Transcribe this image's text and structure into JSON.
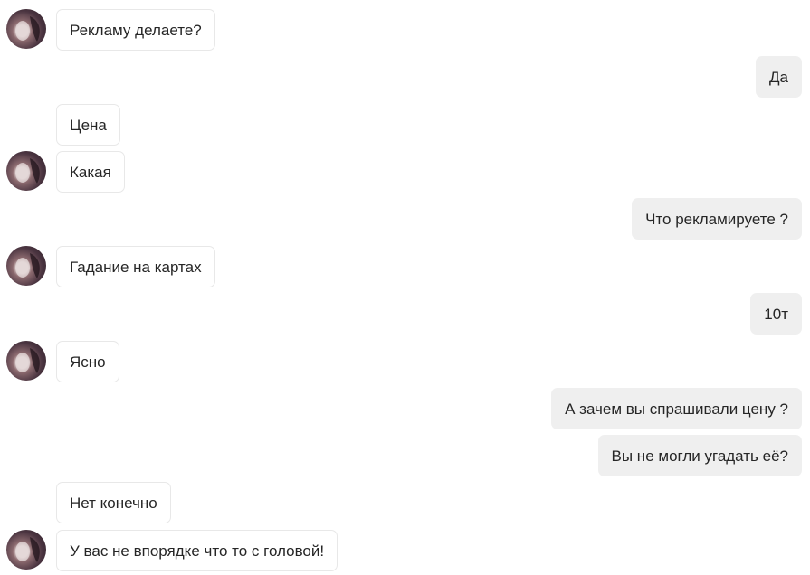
{
  "messages": [
    {
      "side": "in",
      "avatar": true,
      "text": "Рекламу делаете?"
    },
    {
      "side": "out",
      "avatar": false,
      "text": "Да"
    },
    {
      "side": "in",
      "avatar": false,
      "text": "Цена"
    },
    {
      "side": "in",
      "avatar": true,
      "text": "Какая"
    },
    {
      "side": "out",
      "avatar": false,
      "text": "Что рекламируете ?"
    },
    {
      "side": "in",
      "avatar": true,
      "text": "Гадание на картах"
    },
    {
      "side": "out",
      "avatar": false,
      "text": "10т"
    },
    {
      "side": "in",
      "avatar": true,
      "text": "Ясно"
    },
    {
      "side": "out",
      "avatar": false,
      "text": "А зачем вы спрашивали цену ?"
    },
    {
      "side": "out",
      "avatar": false,
      "text": "Вы не могли угадать её?"
    },
    {
      "side": "in",
      "avatar": false,
      "text": "Нет конечно"
    },
    {
      "side": "in",
      "avatar": true,
      "text": "У вас не впорядке что то с головой!"
    }
  ],
  "colors": {
    "incoming_bg": "#ffffff",
    "incoming_border": "#e8e8e8",
    "outgoing_bg": "#efefef",
    "text": "#262626"
  }
}
